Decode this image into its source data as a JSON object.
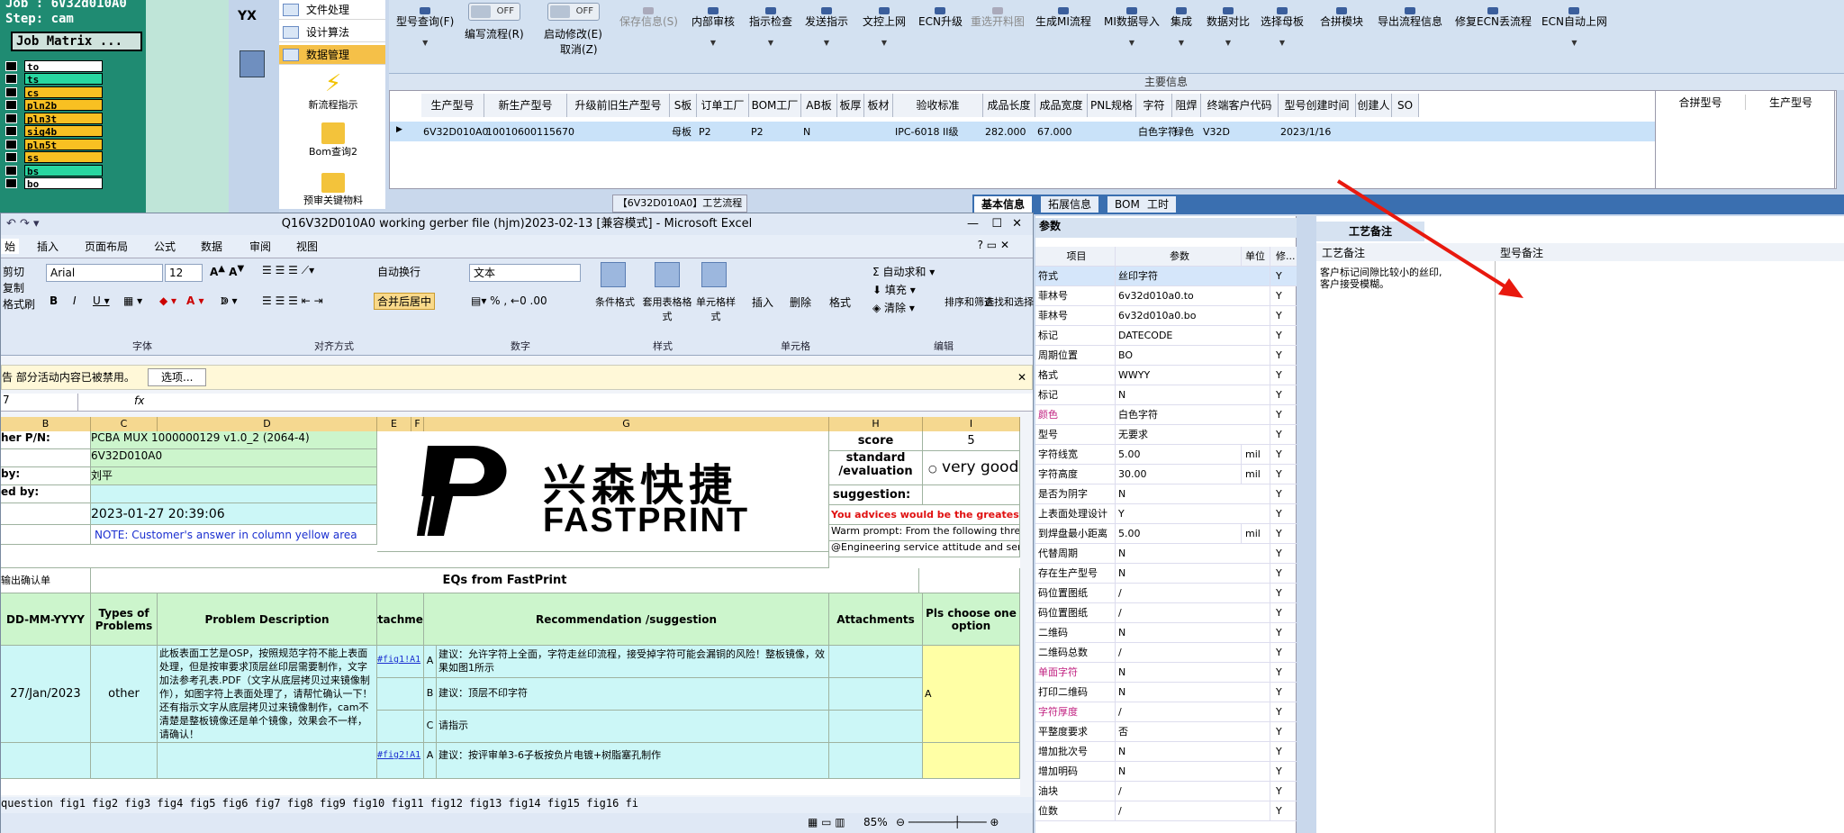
{
  "cam": {
    "job_line": "Job : 6V32d010A0",
    "step_line": "Step: cam",
    "job_matrix": "Job Matrix ...",
    "layers": [
      {
        "name": "to",
        "color": "#ffffff"
      },
      {
        "name": "ts",
        "color": "#28d7a0"
      },
      {
        "name": "cs",
        "color": "#f8c022"
      },
      {
        "name": "pln2b",
        "color": "#f8c022"
      },
      {
        "name": "pln3t",
        "color": "#f8c022"
      },
      {
        "name": "sig4b",
        "color": "#f8c022"
      },
      {
        "name": "pln5t",
        "color": "#f8c022"
      },
      {
        "name": "ss",
        "color": "#f8c022"
      },
      {
        "name": "bs",
        "color": "#28d7a0"
      },
      {
        "name": "bo",
        "color": "#ffffff"
      }
    ]
  },
  "yx_logo": "YX",
  "nav": {
    "items": [
      "文件处理",
      "设计算法",
      "数据管理"
    ],
    "big_items": [
      "新流程指示",
      "Bom查询2",
      "预审关键物料"
    ]
  },
  "toolbar": {
    "items": [
      "型号查询(F)",
      "编写流程(R)",
      "启动修改(E)",
      "取消(Z)",
      "保存信息(S)",
      "内部审核",
      "指示检查",
      "发送指示",
      "文控上网",
      "ECN升级",
      "重选开料图",
      "生成MI流程",
      "MI数据导入",
      "集成",
      "数据对比",
      "选择母板",
      "合拼模块",
      "导出流程信息",
      "修复ECN丢流程",
      "ECN自动上网"
    ],
    "toggle_off": "OFF"
  },
  "main_info": "主要信息",
  "grid": {
    "headers": [
      "生产型号",
      "新生产型号",
      "升级前旧生产型号",
      "S板",
      "订单工厂",
      "BOM工厂",
      "AB板",
      "板厚",
      "板材",
      "验收标准",
      "成品长度",
      "成品宽度",
      "PNL规格",
      "字符",
      "阻焊",
      "终端客户代码",
      "型号创建时间",
      "创建人",
      "SO"
    ],
    "row": [
      "6V32D010A0",
      "10010600115670",
      "",
      "母板",
      "P2",
      "P2",
      "N",
      "",
      "",
      "IPC-6018 II级",
      "282.000",
      "67.000",
      "",
      "白色字符",
      "绿色",
      "V32D",
      "2023/1/16",
      "",
      ""
    ],
    "right_headers": [
      "合拼型号",
      "生产型号"
    ]
  },
  "tabs": {
    "process": "【6V32D010A0】工艺流程",
    "basic": "基本信息",
    "ext": "拓展信息",
    "bom": "BOM",
    "hours": "工时"
  },
  "param": {
    "title": "参数",
    "headers": [
      "项目",
      "参数",
      "单位",
      "修..."
    ],
    "rows": [
      [
        "符式",
        "丝印字符",
        "",
        "Y"
      ],
      [
        "菲林号",
        "6v32d010a0.to",
        "",
        "Y"
      ],
      [
        "菲林号",
        "6v32d010a0.bo",
        "",
        "Y"
      ],
      [
        "标记",
        "DATECODE",
        "",
        "Y"
      ],
      [
        "周期位置",
        "BO",
        "",
        "Y"
      ],
      [
        "格式",
        "WWYY",
        "",
        "Y"
      ],
      [
        "标记",
        "N",
        "",
        "Y"
      ],
      [
        "颜色",
        "白色字符",
        "",
        "Y"
      ],
      [
        "型号",
        "无要求",
        "",
        "Y"
      ],
      [
        "字符线宽",
        "5.00",
        "mil",
        "Y"
      ],
      [
        "字符高度",
        "30.00",
        "mil",
        "Y"
      ],
      [
        "是否为阴字",
        "N",
        "",
        "Y"
      ],
      [
        "上表面处理设计",
        "Y",
        "",
        "Y"
      ],
      [
        "到焊盘最小距离",
        "5.00",
        "mil",
        "Y"
      ],
      [
        "代替周期",
        "N",
        "",
        "Y"
      ],
      [
        "存在生产型号",
        "N",
        "",
        "Y"
      ],
      [
        "码位置图纸",
        "/",
        "",
        "Y"
      ],
      [
        "码位置图纸",
        "/",
        "",
        "Y"
      ],
      [
        "二维码",
        "N",
        "",
        "Y"
      ],
      [
        "二维码总数",
        "/",
        "",
        "Y"
      ],
      [
        "单面字符",
        "N",
        "",
        "Y"
      ],
      [
        "打印二维码",
        "N",
        "",
        "Y"
      ],
      [
        "字符厚度",
        "/",
        "",
        "Y"
      ],
      [
        "平整度要求",
        "否",
        "",
        "Y"
      ],
      [
        "增加批次号",
        "N",
        "",
        "Y"
      ],
      [
        "增加明码",
        "N",
        "",
        "Y"
      ],
      [
        "油块",
        "/",
        "",
        "Y"
      ],
      [
        "位数",
        "/",
        "",
        "Y"
      ]
    ]
  },
  "remarks": {
    "title": "工艺备注",
    "col1": "工艺备注",
    "col2": "型号备注",
    "text1": "客户标记间隙比较小的丝印,",
    "text2": "客户接受模糊。"
  },
  "excel": {
    "title": "Q16V32D010A0 working gerber file (hjm)2023-02-13  [兼容模式] - Microsoft Excel",
    "tabs": [
      "始",
      "插入",
      "页面布局",
      "公式",
      "数据",
      "审阅",
      "视图"
    ],
    "font_name": "Arial",
    "font_size": "12",
    "num_format": "文本",
    "labels": {
      "cut": "剪切",
      "copy": "复制",
      "painter": "格式刷",
      "font": "字体",
      "align": "对齐方式",
      "number": "数字",
      "styles": "样式",
      "cells": "单元格",
      "edit": "编辑",
      "wrap": "自动换行",
      "merge": "合并后居中",
      "cond": "条件格式",
      "table": "套用表格格式",
      "cellstyle": "单元格样式",
      "insert": "插入",
      "delete": "删除",
      "format": "格式",
      "autosum": "自动求和",
      "fill": "填充",
      "clear": "清除",
      "sort": "排序和筛选",
      "find": "查找和选择"
    },
    "security": "告  部分活动内容已被禁用。",
    "options": "选项...",
    "namebox": "7",
    "fx": "fx",
    "cols": [
      "B",
      "C",
      "D",
      "E",
      "F",
      "G",
      "H",
      "I"
    ],
    "cells": {
      "pn_label": "her P/N:",
      "pn": "PCBA MUX 1000000129 v1.0_2 (2064-4)",
      "model": "6V32D010A0",
      "by_label": "by:",
      "by": "刘平",
      "checked_label": "ed by:",
      "date": "2023-01-27 20:39:06",
      "note": "NOTE: Customer's  answer in column yellow area",
      "score_label": "score",
      "score": "5",
      "std_label": "standard /evaluation",
      "std_value": "very good",
      "sugg_label": "suggestion:",
      "advice": "You advices would be the greatest po",
      "warm1": "Warm prompt:  From the following thre",
      "warm2": "@Engineering service attitude and ser",
      "confirm": "输出确认单",
      "eq_title": "EQs from FastPrint",
      "date_h": "DD-MM-YYYY",
      "types_h": "Types of Problems",
      "problem_h": "Problem Description",
      "attach_h": "Attachment",
      "rec_h": "Recommendation /suggestion",
      "attachments_h": "Attachments",
      "choose_h": "Pls choose one option",
      "row_date": "27/Jan/2023",
      "row_type": "other",
      "problem": "此板表面工艺是OSP，按照规范字符不能上表面处理，但是按审要求顶层丝印层需要制作，文字加法参考孔表.PDF（文字从底层拷贝过来镜像制作），如图字符上表面处理了，请帮忙确认一下！还有指示文字从底层拷贝过来镜像制作，cam不清楚是整板镜像还是单个镜像，效果会不一样，请确认！",
      "fig1": "#fig1!A1",
      "fig2": "#fig2!A1",
      "opt_a": "A",
      "opt_b": "B",
      "opt_c": "C",
      "rec_a": "建议：允许字符上全面，字符走丝印流程，接受掉字符可能会漏铜的风险！整板镜像，效果如图1所示",
      "rec_b": "建议：顶层不印字符",
      "rec_c": "请指示",
      "choice": "A",
      "rec_2a": "建议：按评审单3-6子板按负片电镀+树脂塞孔制作"
    },
    "logo_cn": "兴森快捷",
    "logo_en": "FASTPRINT",
    "sheet_tabs": "question  fig1  fig2  fig3  fig4  fig5  fig6  fig7  fig8  fig9  fig10  fig11  fig12  fig13  fig14  fig15  fig16  fi",
    "zoom": "85%"
  }
}
